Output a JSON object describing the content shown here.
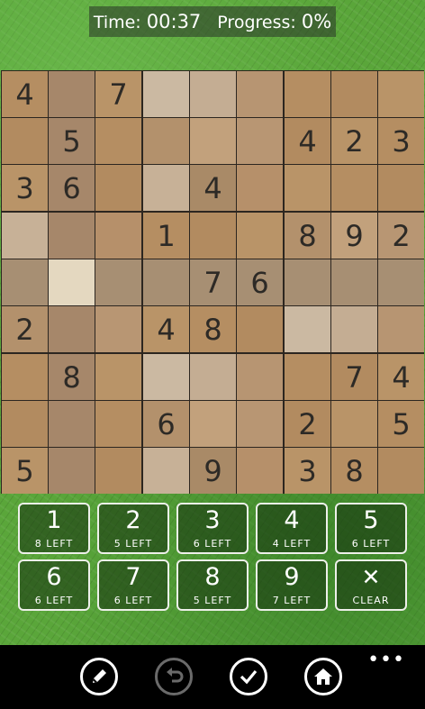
{
  "status": {
    "time_label": "Time:",
    "time_value": "00:37",
    "progress_label": "Progress:",
    "progress_value": "0%"
  },
  "board": {
    "cells": [
      [
        "4",
        "",
        "7",
        "",
        "",
        "",
        "",
        "",
        ""
      ],
      [
        "",
        "5",
        "",
        "",
        "",
        "",
        "4",
        "2",
        "3"
      ],
      [
        "3",
        "6",
        "",
        "",
        "4",
        "",
        "",
        "",
        ""
      ],
      [
        "",
        "",
        "",
        "1",
        "",
        "",
        "8",
        "9",
        "2"
      ],
      [
        "",
        "",
        "",
        "",
        "7",
        "6",
        "",
        "",
        ""
      ],
      [
        "2",
        "",
        "",
        "4",
        "8",
        "",
        "",
        "",
        ""
      ],
      [
        "",
        "8",
        "",
        "",
        "",
        "",
        "",
        "7",
        "4"
      ],
      [
        "",
        "",
        "",
        "6",
        "",
        "",
        "2",
        "",
        "5"
      ],
      [
        "5",
        "",
        "",
        "",
        "9",
        "",
        "3",
        "8",
        ""
      ]
    ],
    "selected": [
      4,
      1
    ]
  },
  "keypad": {
    "keys": [
      {
        "num": "1",
        "left": "8 LEFT"
      },
      {
        "num": "2",
        "left": "5 LEFT"
      },
      {
        "num": "3",
        "left": "6 LEFT"
      },
      {
        "num": "4",
        "left": "4 LEFT"
      },
      {
        "num": "5",
        "left": "6 LEFT"
      },
      {
        "num": "6",
        "left": "6 LEFT"
      },
      {
        "num": "7",
        "left": "6 LEFT"
      },
      {
        "num": "8",
        "left": "5 LEFT"
      },
      {
        "num": "9",
        "left": "7 LEFT"
      }
    ],
    "clear_icon": "✕",
    "clear_label": "CLEAR"
  },
  "appbar": {
    "buttons": [
      {
        "icon": "pencil-icon",
        "enabled": true
      },
      {
        "icon": "undo-icon",
        "enabled": false
      },
      {
        "icon": "check-icon",
        "enabled": true
      },
      {
        "icon": "home-icon",
        "enabled": true
      }
    ],
    "more_label": "•••"
  },
  "colors": {
    "grass": "#5aa63a",
    "tile_light": "#c9b39a",
    "tile_tan": "#b58e62",
    "tile_selected": "#e4d8c0",
    "digit": "#2d2a26"
  }
}
